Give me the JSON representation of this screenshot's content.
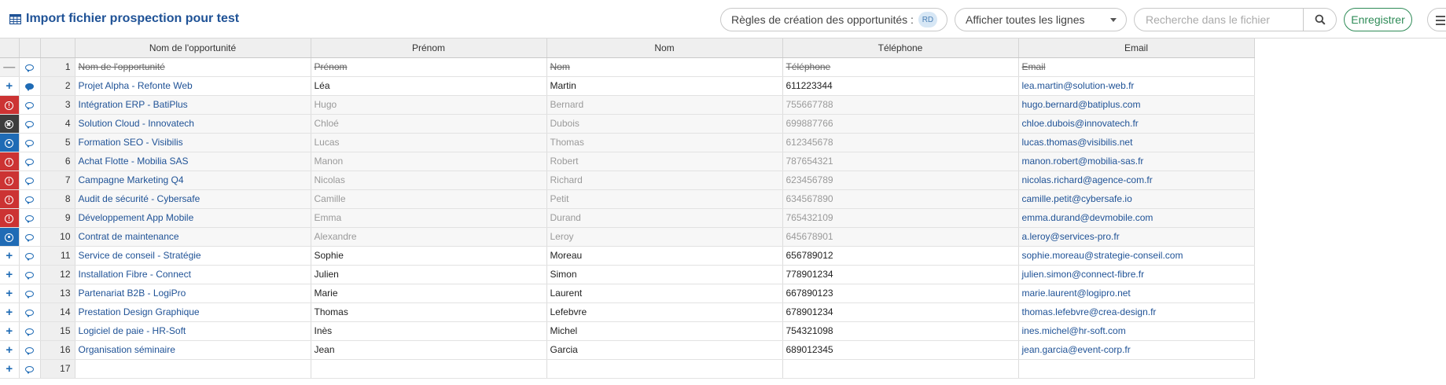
{
  "header": {
    "title": "Import fichier prospection pour test",
    "rules_label": "Règles de création des opportunités :",
    "rules_badge": "RD",
    "filter_selected": "Afficher toutes les lignes",
    "search_placeholder": "Recherche dans le fichier",
    "save_label": "Enregistrer"
  },
  "colors": {
    "accent": "#1f5296",
    "error": "#cc3333",
    "info": "#1f6bb5",
    "blocked": "#3d3d3d",
    "save": "#2e8b57"
  },
  "icons": {
    "title": "table-icon",
    "search": "search-icon",
    "menu": "menu-icon",
    "comment": "comment-icon",
    "status_error": "exclamation-circle-icon",
    "status_info": "info-circle-icon",
    "status_blocked": "x-circle-icon",
    "status_add": "plus-icon",
    "status_header": "minus-icon"
  },
  "columns": [
    "Nom de l'opportunité",
    "Prénom",
    "Nom",
    "Téléphone",
    "Email"
  ],
  "rows": [
    {
      "num": "1",
      "status": "header",
      "comment": "empty",
      "style": "strike",
      "cells": [
        "Nom de l'opportunité",
        "Prénom",
        "Nom",
        "Téléphone",
        "Email"
      ]
    },
    {
      "num": "2",
      "status": "add",
      "comment": "filled",
      "style": "normal",
      "cells": [
        "Projet Alpha - Refonte Web",
        "Léa",
        "Martin",
        "611223344",
        "lea.martin@solution-web.fr"
      ]
    },
    {
      "num": "3",
      "status": "error",
      "comment": "empty",
      "style": "muted",
      "cells": [
        "Intégration ERP - BatiPlus",
        "Hugo",
        "Bernard",
        "755667788",
        "hugo.bernard@batiplus.com"
      ]
    },
    {
      "num": "4",
      "status": "blocked",
      "comment": "empty",
      "style": "muted",
      "cells": [
        "Solution Cloud - Innovatech",
        "Chloé",
        "Dubois",
        "699887766",
        "chloe.dubois@innovatech.fr"
      ]
    },
    {
      "num": "5",
      "status": "info",
      "comment": "empty",
      "style": "muted",
      "cells": [
        "Formation SEO - Visibilis",
        "Lucas",
        "Thomas",
        "612345678",
        "lucas.thomas@visibilis.net"
      ]
    },
    {
      "num": "6",
      "status": "error",
      "comment": "empty",
      "style": "muted",
      "cells": [
        "Achat Flotte - Mobilia SAS",
        "Manon",
        "Robert",
        "787654321",
        "manon.robert@mobilia-sas.fr"
      ]
    },
    {
      "num": "7",
      "status": "error",
      "comment": "empty",
      "style": "muted",
      "cells": [
        "Campagne Marketing Q4",
        "Nicolas",
        "Richard",
        "623456789",
        "nicolas.richard@agence-com.fr"
      ]
    },
    {
      "num": "8",
      "status": "error",
      "comment": "empty",
      "style": "muted",
      "cells": [
        "Audit de sécurité - Cybersafe",
        "Camille",
        "Petit",
        "634567890",
        "camille.petit@cybersafe.io"
      ]
    },
    {
      "num": "9",
      "status": "error",
      "comment": "empty",
      "style": "muted",
      "cells": [
        "Développement App Mobile",
        "Emma",
        "Durand",
        "765432109",
        "emma.durand@devmobile.com"
      ]
    },
    {
      "num": "10",
      "status": "info",
      "comment": "empty",
      "style": "muted",
      "cells": [
        "Contrat de maintenance",
        "Alexandre",
        "Leroy",
        "645678901",
        "a.leroy@services-pro.fr"
      ]
    },
    {
      "num": "11",
      "status": "add",
      "comment": "empty",
      "style": "normal",
      "cells": [
        "Service de conseil - Stratégie",
        "Sophie",
        "Moreau",
        "656789012",
        "sophie.moreau@strategie-conseil.com"
      ]
    },
    {
      "num": "12",
      "status": "add",
      "comment": "empty",
      "style": "normal",
      "cells": [
        "Installation Fibre - Connect",
        "Julien",
        "Simon",
        "778901234",
        "julien.simon@connect-fibre.fr"
      ]
    },
    {
      "num": "13",
      "status": "add",
      "comment": "empty",
      "style": "normal",
      "cells": [
        "Partenariat B2B - LogiPro",
        "Marie",
        "Laurent",
        "667890123",
        "marie.laurent@logipro.net"
      ]
    },
    {
      "num": "14",
      "status": "add",
      "comment": "empty",
      "style": "normal",
      "cells": [
        "Prestation Design Graphique",
        "Thomas",
        "Lefebvre",
        "678901234",
        "thomas.lefebvre@crea-design.fr"
      ]
    },
    {
      "num": "15",
      "status": "add",
      "comment": "empty",
      "style": "normal",
      "cells": [
        "Logiciel de paie - HR-Soft",
        "Inès",
        "Michel",
        "754321098",
        "ines.michel@hr-soft.com"
      ]
    },
    {
      "num": "16",
      "status": "add",
      "comment": "empty",
      "style": "normal",
      "cells": [
        "Organisation séminaire",
        "Jean",
        "Garcia",
        "689012345",
        "jean.garcia@event-corp.fr"
      ]
    },
    {
      "num": "17",
      "status": "add",
      "comment": "empty",
      "style": "normal",
      "cells": [
        "",
        "",
        "",
        "",
        ""
      ]
    }
  ]
}
